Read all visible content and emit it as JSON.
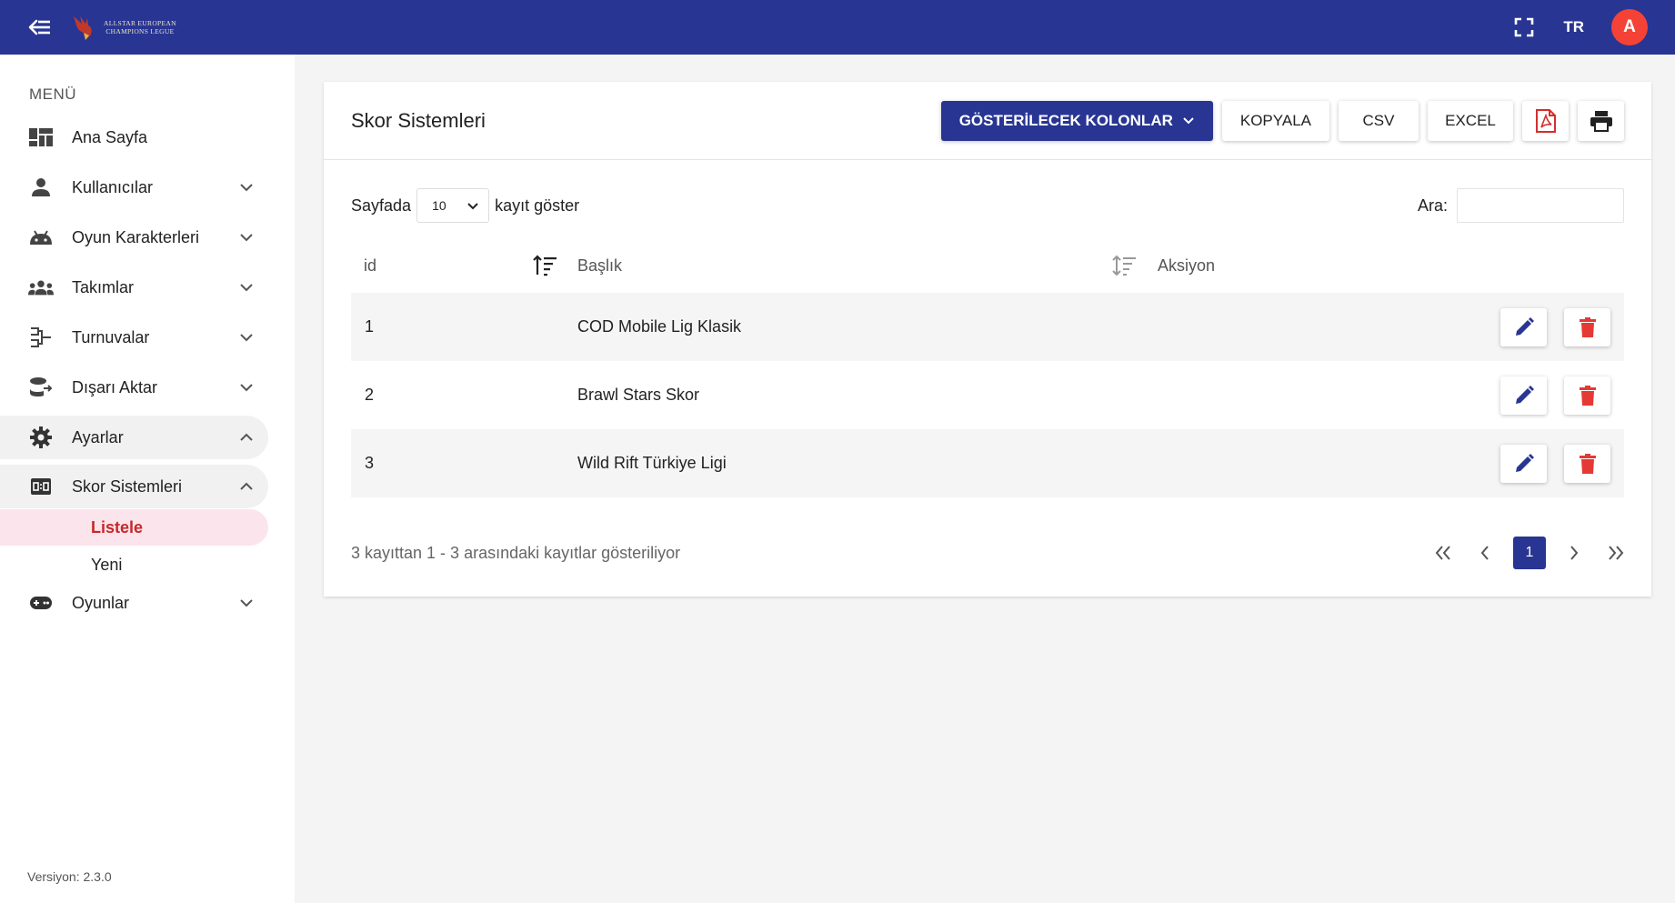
{
  "topbar": {
    "logo_line1": "ALLSTAR EUROPEAN",
    "logo_line2": "CHAMPIONS LEGUE",
    "lang": "TR",
    "avatar_initial": "A"
  },
  "sidebar": {
    "menu_title": "MENÜ",
    "items": [
      {
        "label": "Ana Sayfa"
      },
      {
        "label": "Kullanıcılar"
      },
      {
        "label": "Oyun Karakterleri"
      },
      {
        "label": "Takımlar"
      },
      {
        "label": "Turnuvalar"
      },
      {
        "label": "Dışarı Aktar"
      },
      {
        "label": "Ayarlar"
      },
      {
        "label": "Skor Sistemleri"
      },
      {
        "label": "Oyunlar"
      }
    ],
    "sub_items": [
      {
        "label": "Listele"
      },
      {
        "label": "Yeni"
      }
    ],
    "version": "Versiyon: 2.3.0"
  },
  "main": {
    "title": "Skor Sistemleri",
    "toolbar": {
      "columns_label": "GÖSTERİLECEK KOLONLAR",
      "copy_label": "KOPYALA",
      "csv_label": "CSV",
      "excel_label": "EXCEL"
    },
    "length": {
      "prefix": "Sayfada",
      "value": "10",
      "suffix": "kayıt göster"
    },
    "search_label": "Ara:",
    "columns": {
      "id": "id",
      "title": "Başlık",
      "action": "Aksiyon"
    },
    "rows": [
      {
        "id": "1",
        "title": "COD Mobile Lig Klasik"
      },
      {
        "id": "2",
        "title": "Brawl Stars Skor"
      },
      {
        "id": "3",
        "title": "Wild Rift Türkiye Ligi"
      }
    ],
    "info": "3 kayıttan 1 - 3 arasındaki kayıtlar gösteriliyor",
    "current_page": "1"
  },
  "colors": {
    "primary": "#283593",
    "avatar": "#f44336",
    "delete": "#e53935",
    "active_sub": "#c62828"
  }
}
